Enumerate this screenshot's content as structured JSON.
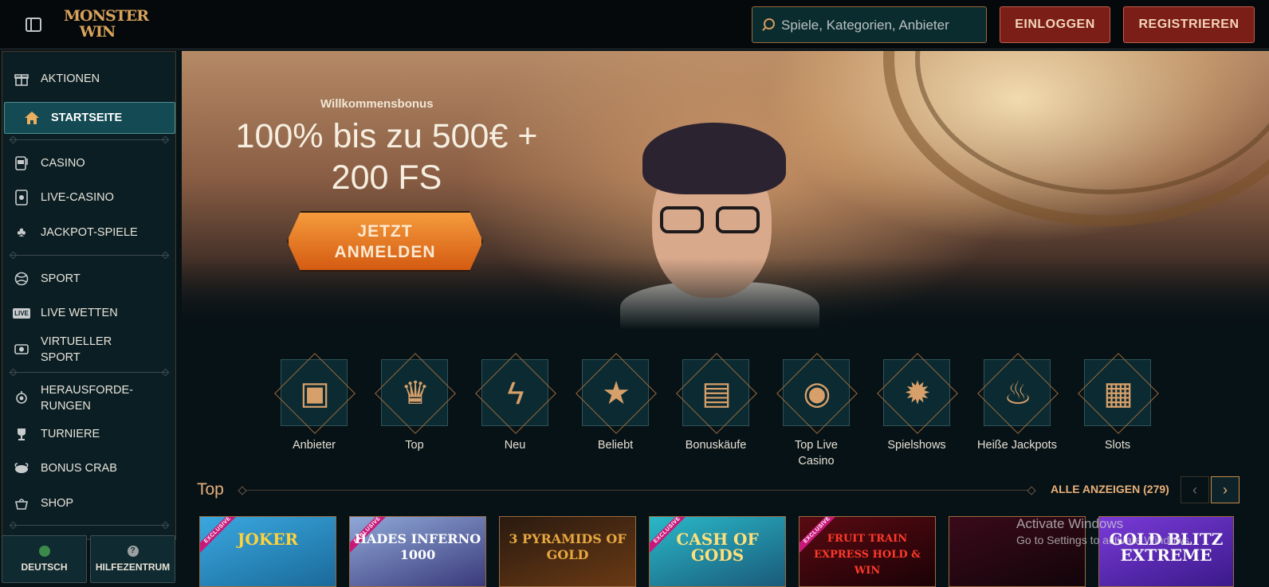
{
  "header": {
    "search_placeholder": "Spiele, Kategorien, Anbieter",
    "login_label": "EINLOGGEN",
    "register_label": "REGISTRIEREN",
    "logo_line1": "MONSTER",
    "logo_line2": "WIN"
  },
  "sidebar": {
    "items": [
      {
        "label": "AKTIONEN",
        "icon": "gift-icon"
      },
      {
        "label": "STARTSEITE",
        "icon": "home-icon",
        "active": true
      },
      {
        "label": "CASINO",
        "icon": "slot-machine-icon"
      },
      {
        "label": "LIVE-CASINO",
        "icon": "cards-icon"
      },
      {
        "label": "JACKPOT-SPIELE",
        "icon": "clover-icon"
      },
      {
        "label": "SPORT",
        "icon": "ball-icon"
      },
      {
        "label": "LIVE WETTEN",
        "icon": "live-icon"
      },
      {
        "label": "VIRTUELLER SPORT",
        "icon": "virtual-sport-icon"
      },
      {
        "label": "HERAUSFORDE-RUNGEN",
        "icon": "challenge-icon"
      },
      {
        "label": "TURNIERE",
        "icon": "trophy-icon"
      },
      {
        "label": "BONUS CRAB",
        "icon": "crab-icon"
      },
      {
        "label": "SHOP",
        "icon": "basket-icon"
      }
    ],
    "live_badge": "LIVE",
    "language_label": "DEUTSCH",
    "help_label": "HILFEZENTRUM"
  },
  "hero": {
    "kicker": "Willkommensbonus",
    "title": "100% bis zu 500€ + 200 FS",
    "cta_line1": "JETZT",
    "cta_line2": "ANMELDEN"
  },
  "categories": [
    {
      "label": "Anbieter",
      "icon": "book-icon"
    },
    {
      "label": "Top",
      "icon": "crown-icon"
    },
    {
      "label": "Neu",
      "icon": "lightning-icon"
    },
    {
      "label": "Beliebt",
      "icon": "star-icon"
    },
    {
      "label": "Bonuskäufe",
      "icon": "gift-box-icon"
    },
    {
      "label": "Top Live Casino",
      "icon": "chip-icon"
    },
    {
      "label": "Spielshows",
      "icon": "wheel-icon"
    },
    {
      "label": "Heiße Jackpots",
      "icon": "flame-icon"
    },
    {
      "label": "Slots",
      "icon": "slot-icon"
    }
  ],
  "section": {
    "title": "Top",
    "view_all": "ALLE ANZEIGEN (279)"
  },
  "games": [
    {
      "title": "JOKER",
      "exclusive": true
    },
    {
      "title": "HADES INFERNO 1000",
      "exclusive": true
    },
    {
      "title": "3 PYRAMIDS OF GOLD",
      "exclusive": false
    },
    {
      "title": "CASH OF GODS",
      "exclusive": true
    },
    {
      "title": "FRUIT TRAIN EXPRESS HOLD & WIN",
      "exclusive": true
    },
    {
      "title": "",
      "exclusive": false
    },
    {
      "title": "GOLD BLITZ EXTREME",
      "exclusive": false
    }
  ],
  "exclusive_label": "EXCLUSIVE",
  "watermark": {
    "line1": "Activate Windows",
    "line2": "Go to Settings to activate Windows."
  },
  "colors": {
    "accent": "#e8b07a",
    "button_red": "#7b1e18",
    "cta_orange": "#f0892c",
    "sidebar_active": "#134a53"
  }
}
